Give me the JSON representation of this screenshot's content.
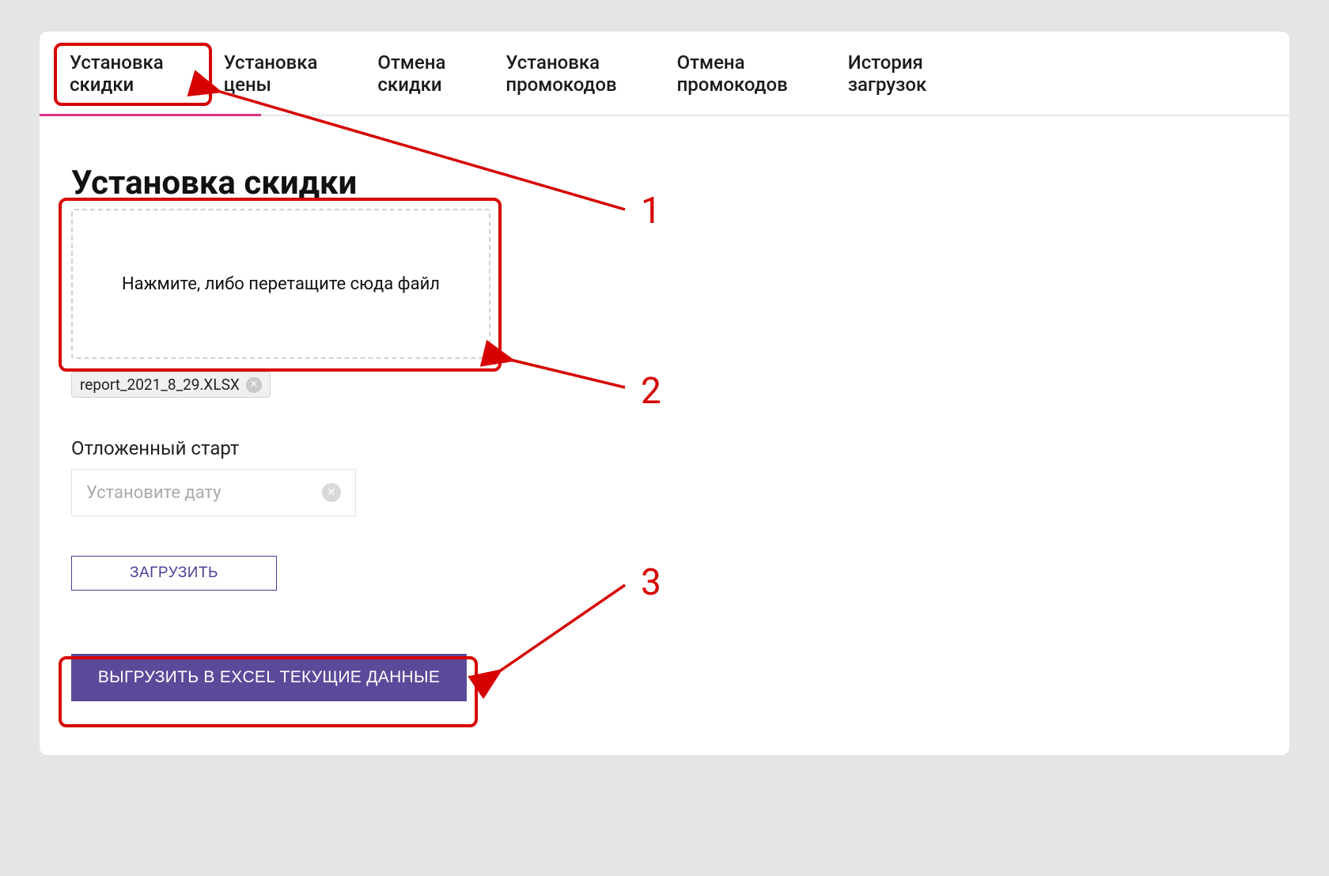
{
  "tabs": [
    {
      "label": "Установка\nскидки"
    },
    {
      "label": "Установка\nцены"
    },
    {
      "label": "Отмена\nскидки"
    },
    {
      "label": "Установка\nпромокодов"
    },
    {
      "label": "Отмена\nпромокодов"
    },
    {
      "label": "История\nзагрузок"
    }
  ],
  "page": {
    "title": "Установка скидки",
    "dropzone_text": "Нажмите, либо перетащите сюда файл",
    "file_chip": "report_2021_8_29.XLSX",
    "delayed_start_label": "Отложенный старт",
    "date_placeholder": "Установите дату",
    "upload_button": "ЗАГРУЗИТЬ",
    "export_button": "ВЫГРУЗИТЬ В EXCEL ТЕКУЩИЕ ДАННЫЕ"
  },
  "annotations": {
    "n1": "1",
    "n2": "2",
    "n3": "3"
  }
}
